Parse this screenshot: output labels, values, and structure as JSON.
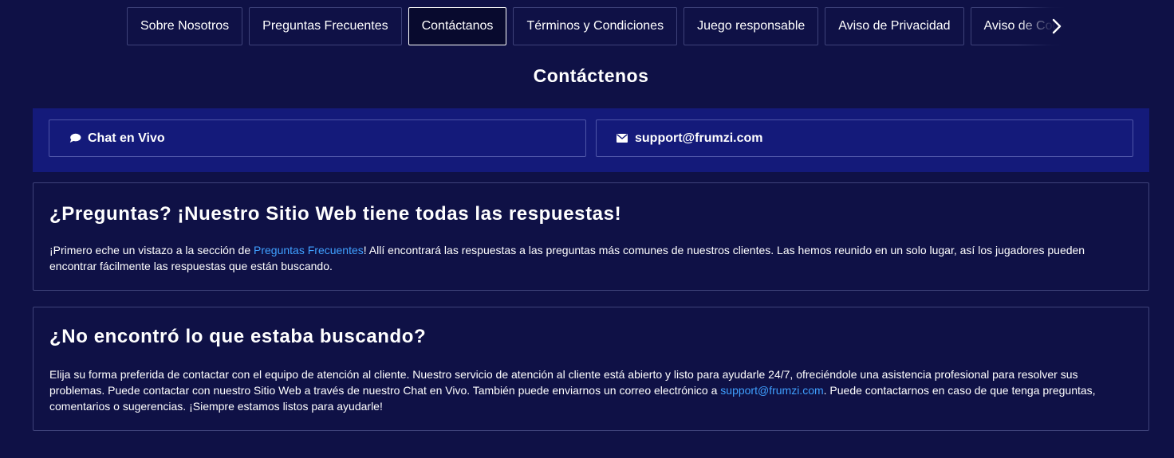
{
  "tabs": [
    {
      "label": "Sobre Nosotros",
      "active": false
    },
    {
      "label": "Preguntas Frecuentes",
      "active": false
    },
    {
      "label": "Contáctanos",
      "active": true
    },
    {
      "label": "Términos y Condiciones",
      "active": false
    },
    {
      "label": "Juego responsable",
      "active": false
    },
    {
      "label": "Aviso de Privacidad",
      "active": false
    },
    {
      "label": "Aviso de Cookies",
      "active": false
    }
  ],
  "tabs_next_icon": "chevron-right-icon",
  "page_title": "Contáctenos",
  "contact": {
    "chat": {
      "label": "Chat en Vivo",
      "icon": "chat-bubble-icon"
    },
    "email": {
      "label": "support@frumzi.com",
      "icon": "envelope-icon"
    }
  },
  "faq_card": {
    "heading": "¿Preguntas? ¡Nuestro Sitio Web tiene todas las respuestas!",
    "text_before_link": "¡Primero eche un vistazo a la sección de ",
    "link": "Preguntas Frecuentes",
    "text_after_link": "! Allí encontrará las respuestas a las preguntas más comunes de nuestros clientes. Las hemos reunido en un solo lugar, así los jugadores pueden encontrar fácilmente las respuestas que están buscando."
  },
  "help_card": {
    "heading": "¿No encontró lo que estaba buscando?",
    "text_before_link": "Elija su forma preferida de contactar con el equipo de atención al cliente. Nuestro servicio de atención al cliente está abierto y listo para ayudarle 24/7, ofreciéndole una asistencia profesional para resolver sus problemas. Puede contactar con nuestro Sitio Web a través de nuestro Chat en Vivo. También puede enviarnos un correo electrónico a ",
    "link": "support@frumzi.com",
    "text_after_link": ". Puede contactarnos en caso de que tenga preguntas, comentarios o sugerencias. ¡Siempre estamos listos para ayudarle!"
  },
  "colors": {
    "background": "#0f1146",
    "contact_band": "#141a7a",
    "border": "#3e4279",
    "link": "#3fa0ff"
  }
}
